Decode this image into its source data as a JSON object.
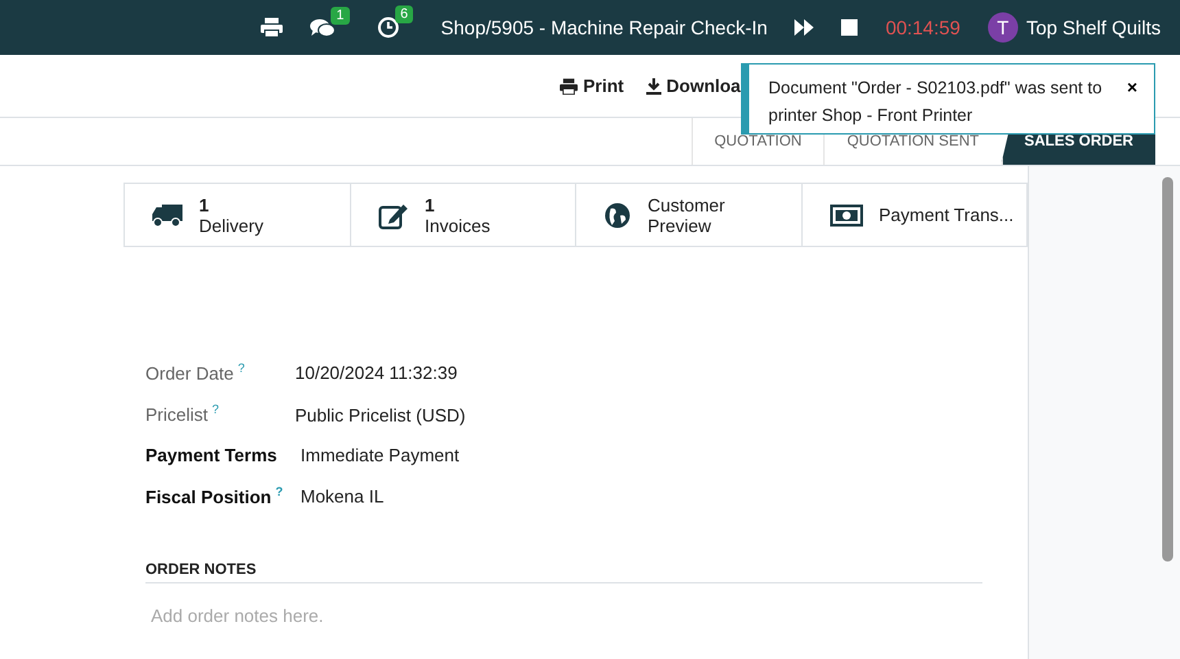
{
  "topbar": {
    "icons": [
      {
        "kind": "print"
      },
      {
        "kind": "chat",
        "badge": "1"
      },
      {
        "kind": "clock",
        "badge": "6"
      }
    ],
    "task": "Shop/5905 - Machine Repair Check-In",
    "timer": "00:14:59",
    "avatar": "T",
    "company": "Top Shelf Quilts"
  },
  "actions": [
    "Print",
    "Downloa"
  ],
  "toast": {
    "message": "Document \"Order - S02103.pdf\" was sent to printer Shop - Front Printer",
    "close": "×"
  },
  "statuses": [
    {
      "label": "QUOTATION",
      "selected": false
    },
    {
      "label": "QUOTATION SENT",
      "selected": false
    },
    {
      "label": "SALES ORDER",
      "selected": true
    }
  ],
  "smart_buttons": [
    {
      "kind": "truck",
      "count": "1",
      "label": "Delivery"
    },
    {
      "kind": "edit",
      "count": "1",
      "label": "Invoices"
    },
    {
      "kind": "globe",
      "label": "Customer Preview"
    },
    {
      "kind": "money",
      "label": "Payment Trans..."
    }
  ],
  "fields": [
    {
      "label": "Order Date",
      "help": "?",
      "value": "10/20/2024 11:32:39",
      "bold": false
    },
    {
      "label": "Pricelist",
      "help": "?",
      "value": "Public Pricelist (USD)",
      "bold": false
    },
    {
      "label": "Payment Terms",
      "value": "Immediate Payment",
      "bold": true
    },
    {
      "label": "Fiscal Position",
      "help": "?",
      "value": "Mokena IL",
      "bold": true
    }
  ],
  "notes": {
    "title": "ORDER NOTES",
    "placeholder": "Add order notes here."
  }
}
